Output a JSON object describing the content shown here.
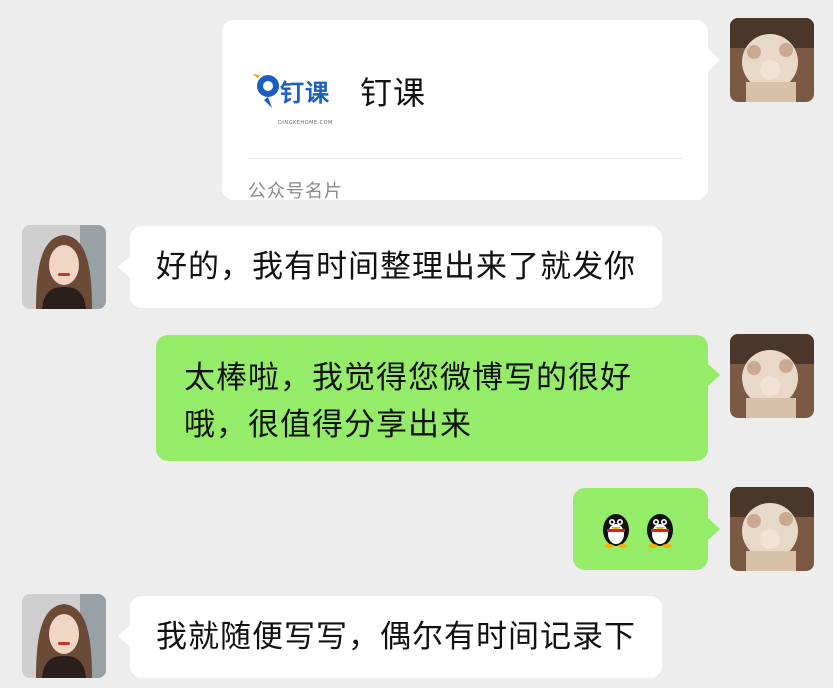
{
  "messages": {
    "card": {
      "logo_text": "钉课",
      "logo_domain": "DINGKEHOME.COM",
      "title": "钉课",
      "footer": "公众号名片"
    },
    "msg1": {
      "text": "好的，我有时间整理出来了就发你"
    },
    "msg2": {
      "line1": "太棒啦，我觉得您微博写的很好",
      "line2": "哦，很值得分享出来"
    },
    "msg3": {
      "emoji": "penguin-emoji"
    },
    "msg4": {
      "text": "我就随便写写，偶尔有时间记录下"
    }
  },
  "colors": {
    "background": "#ededed",
    "sent_bubble": "#95ec69",
    "received_bubble": "#ffffff",
    "logo_blue": "#1a5fc4",
    "logo_orange": "#f5a21b"
  }
}
